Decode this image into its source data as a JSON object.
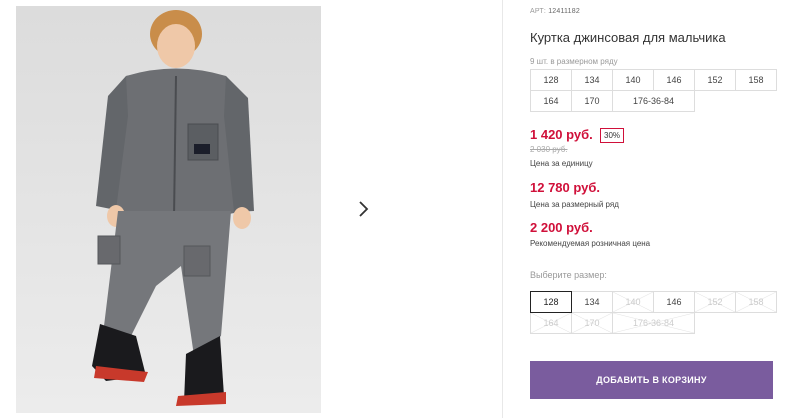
{
  "product": {
    "sku_label": "АРТ:",
    "sku": "12411182",
    "title": "Куртка джинсовая для мальчика",
    "pack_label": "9 шт. в размерном ряду",
    "pack_sizes": [
      "128",
      "134",
      "140",
      "146",
      "152",
      "158",
      "164",
      "170",
      "176-36-84"
    ],
    "price": "1 420 руб.",
    "discount": "30%",
    "old_price": "2 030 руб.",
    "unit_price_label": "Цена за единицу",
    "pack_price": "12 780 руб.",
    "pack_price_label": "Цена за размерный ряд",
    "rrp_price": "2 200 руб.",
    "rrp_label": "Рекомендуемая розничная цена",
    "choose_size_label": "Выберите размер:",
    "size_options": [
      {
        "label": "128",
        "state": "selected"
      },
      {
        "label": "134",
        "state": "available"
      },
      {
        "label": "140",
        "state": "unavailable"
      },
      {
        "label": "146",
        "state": "available"
      },
      {
        "label": "152",
        "state": "unavailable"
      },
      {
        "label": "158",
        "state": "unavailable"
      },
      {
        "label": "164",
        "state": "unavailable"
      },
      {
        "label": "170",
        "state": "unavailable"
      },
      {
        "label": "176-36-84",
        "state": "unavailable"
      }
    ],
    "add_to_cart": "ДОБАВИТЬ В КОРЗИНУ"
  },
  "gallery": {
    "next_icon": "chevron-right-icon"
  },
  "colors": {
    "price": "#d0103a",
    "button": "#7a5c9e"
  }
}
